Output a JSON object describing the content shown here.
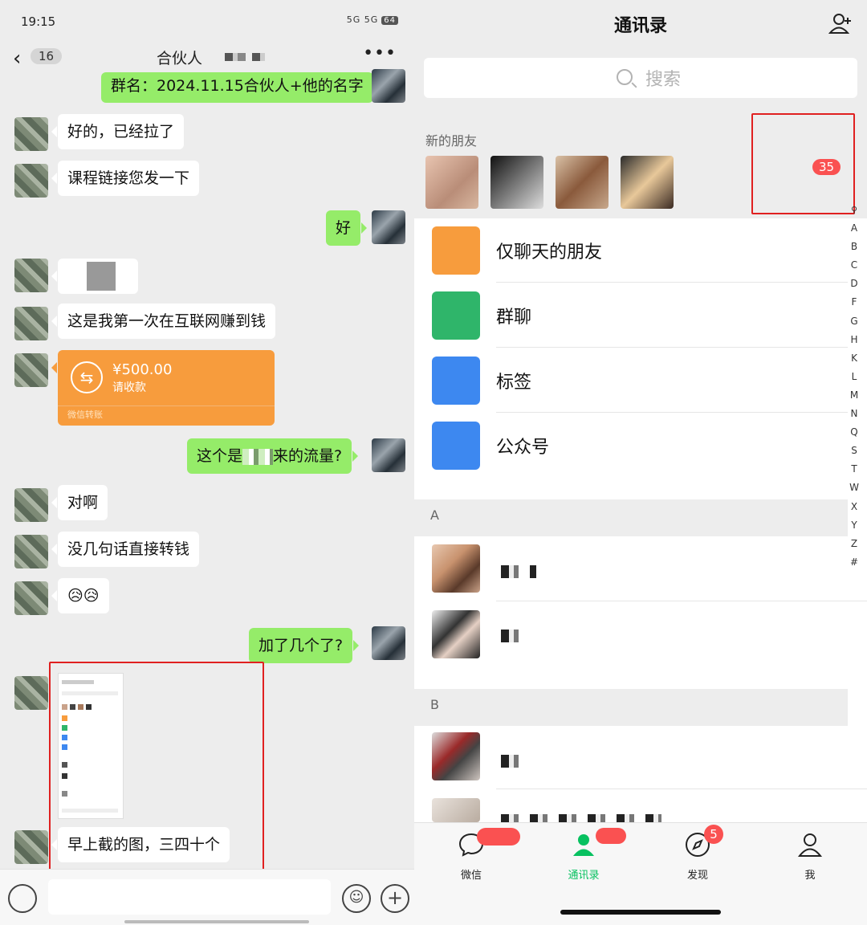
{
  "chat": {
    "status_time": "19:15",
    "status_icons": "5G 5G",
    "battery": "64",
    "back_count": "16",
    "title": "合伙人",
    "more": "•••",
    "messages": [
      {
        "text": "群名：2024.11.15合伙人+他的名字"
      },
      {
        "text": "好的，已经拉了"
      },
      {
        "text": "课程链接您发一下"
      },
      {
        "text": "好"
      },
      {
        "text": "这是我第一次在互联网赚到钱"
      },
      {
        "text": "这个是"
      },
      {
        "text": "来的流量?"
      },
      {
        "text": "对啊"
      },
      {
        "text": "没几句话直接转钱"
      },
      {
        "text": "😥😥"
      },
      {
        "text": "加了几个了?"
      },
      {
        "text": "早上截的图，三四十个"
      }
    ],
    "transfer": {
      "amount": "¥500.00",
      "status": "请收款",
      "footer": "微信转账",
      "icon": "⇆"
    }
  },
  "contacts": {
    "title": "通讯录",
    "search_placeholder": "搜索",
    "new_friends_label": "新的朋友",
    "new_friends_badge": "35",
    "functions": [
      {
        "label": "仅聊天的朋友",
        "color": "#f79c3d"
      },
      {
        "label": "群聊",
        "color": "#2fb56a"
      },
      {
        "label": "标签",
        "color": "#3d88f0"
      },
      {
        "label": "公众号",
        "color": "#3d88f0"
      }
    ],
    "sections": [
      "A",
      "B"
    ],
    "alphabet": [
      "A",
      "B",
      "C",
      "D",
      "F",
      "G",
      "H",
      "K",
      "L",
      "M",
      "N",
      "Q",
      "S",
      "T",
      "W",
      "X",
      "Y",
      "Z",
      "#"
    ]
  },
  "tabbar": {
    "tabs": [
      {
        "label": "微信"
      },
      {
        "label": "通讯录"
      },
      {
        "label": "发现",
        "badge": "5"
      },
      {
        "label": "我"
      }
    ]
  }
}
